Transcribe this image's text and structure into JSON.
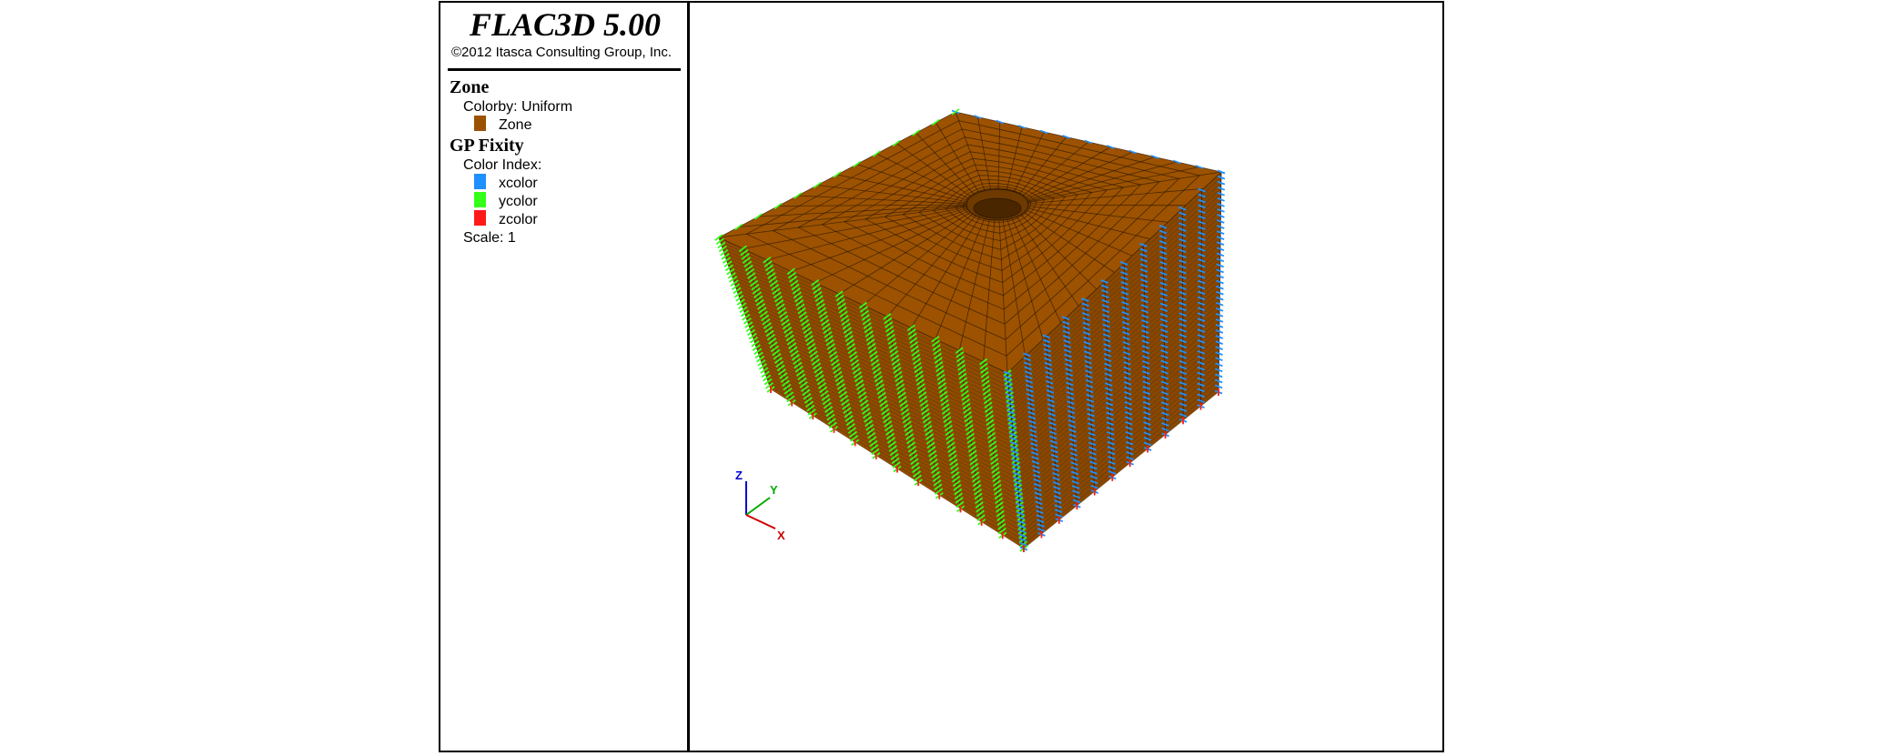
{
  "header": {
    "app_title": "FLAC3D 5.00",
    "copyright": "©2012 Itasca Consulting Group, Inc."
  },
  "legend": {
    "zone": {
      "title": "Zone",
      "colorby": "Colorby: Uniform",
      "item_label": "Zone",
      "item_color": "#9A5200"
    },
    "gp_fixity": {
      "title": "GP Fixity",
      "color_index_label": "Color Index:",
      "items": [
        {
          "label": "xcolor",
          "color": "#1E90FF"
        },
        {
          "label": "ycolor",
          "color": "#33FF1A"
        },
        {
          "label": "zcolor",
          "color": "#FF1A1A"
        }
      ],
      "scale": "Scale: 1"
    }
  },
  "axes": {
    "z_label": "Z",
    "y_label": "Y",
    "x_label": "X",
    "z_color": "#0000CC",
    "y_color": "#00AA00",
    "x_color": "#CC0000"
  },
  "colors": {
    "zone_top": "#9C5200",
    "zone_left": "#8E4B00",
    "zone_right": "#874700",
    "mesh_line": "#2A1600"
  }
}
